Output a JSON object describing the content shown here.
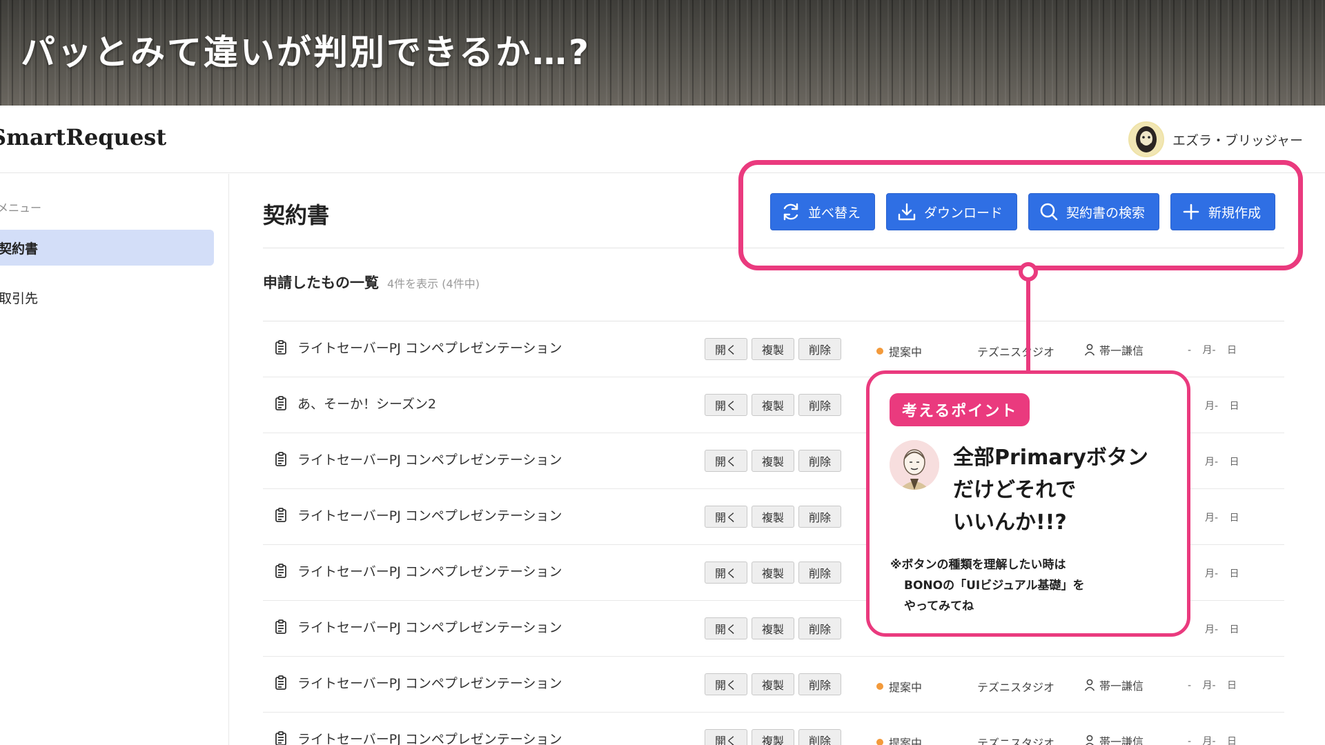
{
  "banner": {
    "title": "パッとみて違いが判別できるか…?"
  },
  "header": {
    "logo": "SmartRequest",
    "user_name": "エズラ・ブリッジャー"
  },
  "sidebar": {
    "heading": "メニュー",
    "items": [
      {
        "label": "契約書",
        "active": true
      },
      {
        "label": "取引先",
        "active": false
      }
    ]
  },
  "main": {
    "title": "契約書",
    "toolbar": [
      {
        "label": "並べ替え",
        "icon": "refresh-icon"
      },
      {
        "label": "ダウンロード",
        "icon": "download-icon"
      },
      {
        "label": "契約書の検索",
        "icon": "search-icon"
      },
      {
        "label": "新規作成",
        "icon": "plus-icon"
      }
    ],
    "list_title": "申請したもの一覧",
    "list_count": "4件を表示 (4件中)",
    "row_actions": {
      "open": "開く",
      "copy": "複製",
      "delete": "削除"
    },
    "rows": [
      {
        "title": "ライトセーバーPJ コンペプレゼンテーション",
        "status": "提案中",
        "company": "テズニスタジオ",
        "assignee": "帯一謙信",
        "date": "- 月- 日"
      },
      {
        "title": "あ、そーか！シーズン2",
        "status": "",
        "company": "",
        "assignee": "",
        "date": "月- 日"
      },
      {
        "title": "ライトセーバーPJ コンペプレゼンテーション",
        "status": "",
        "company": "",
        "assignee": "",
        "date": "月- 日"
      },
      {
        "title": "ライトセーバーPJ コンペプレゼンテーション",
        "status": "",
        "company": "",
        "assignee": "",
        "date": "月- 日"
      },
      {
        "title": "ライトセーバーPJ コンペプレゼンテーション",
        "status": "",
        "company": "",
        "assignee": "",
        "date": "月- 日"
      },
      {
        "title": "ライトセーバーPJ コンペプレゼンテーション",
        "status": "",
        "company": "",
        "assignee": "",
        "date": "月- 日"
      },
      {
        "title": "ライトセーバーPJ コンペプレゼンテーション",
        "status": "提案中",
        "company": "テズニスタジオ",
        "assignee": "帯一謙信",
        "date": "- 月- 日"
      },
      {
        "title": "ライトセーバーPJ コンペプレゼンテーション",
        "status": "提案中",
        "company": "テズニスタジオ",
        "assignee": "帯一謙信",
        "date": "- 月- 日"
      }
    ]
  },
  "callout": {
    "tag": "考えるポイント",
    "main_lines": [
      "全部Primaryボタン",
      "だけどそれで",
      "いいんか!!?"
    ],
    "note_lines": [
      "※ボタンの種類を理解したい時は",
      "BONOの「UIビジュアル基礎」を",
      "やってみてね"
    ]
  },
  "colors": {
    "primary": "#2f6fe4",
    "annotation": "#ea3a7e",
    "status_dot": "#f39a3b",
    "sidebar_active": "#d3def8"
  }
}
